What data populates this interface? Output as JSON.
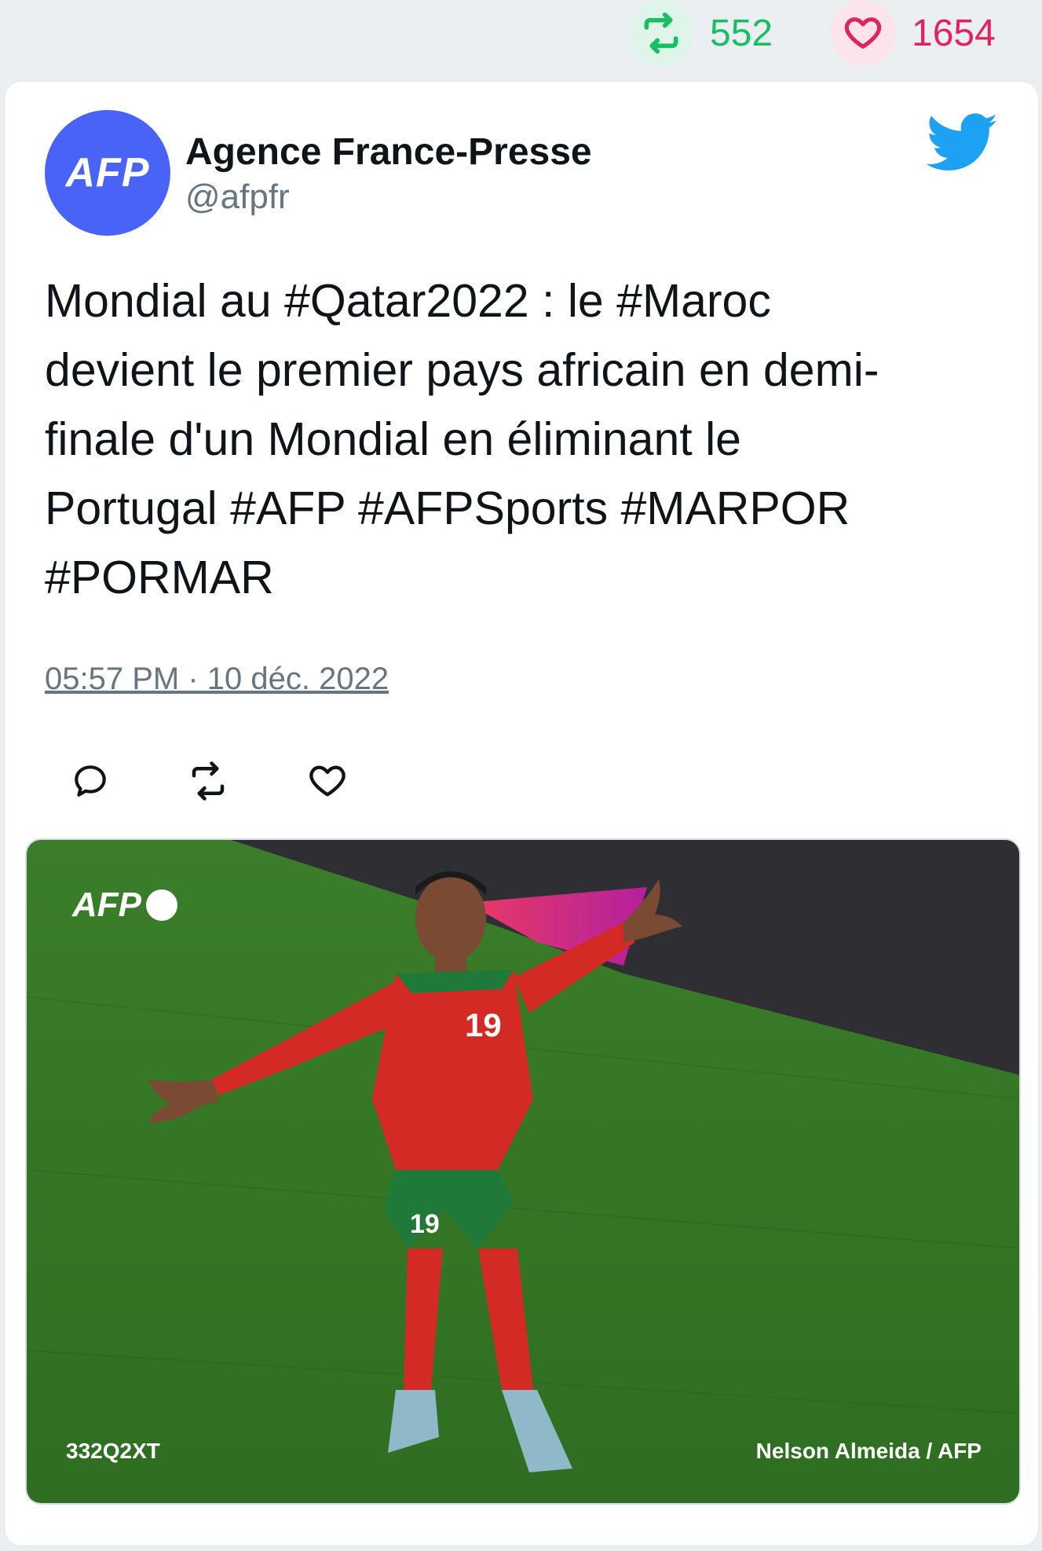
{
  "stats": {
    "retweet_count": "552",
    "like_count": "1654"
  },
  "author": {
    "avatar_text": "AFP",
    "name": "Agence France-Presse",
    "handle": "@afpfr"
  },
  "tweet": {
    "text": "Mondial au #Qatar2022 : le #Maroc\ndevient le premier pays africain en demi-\nfinale d'un Mondial en éliminant le\nPortugal #AFP #AFPSports #MARPOR\n#PORMAR",
    "timestamp": "05:57 PM · 10 déc. 2022"
  },
  "photo": {
    "logo_text": "AFP",
    "jersey_number": "19",
    "photo_id": "332Q2XT",
    "credit": "Nelson Almeida / AFP"
  },
  "icons": {
    "retweet": "retweet-icon",
    "like": "heart-icon",
    "reply": "reply-icon",
    "brand": "twitter-bird-icon"
  },
  "colors": {
    "retweet_green": "#17bf63",
    "like_red": "#e0245e",
    "avatar_blue": "#4a63f7",
    "twitter_blue": "#1da1f2"
  }
}
